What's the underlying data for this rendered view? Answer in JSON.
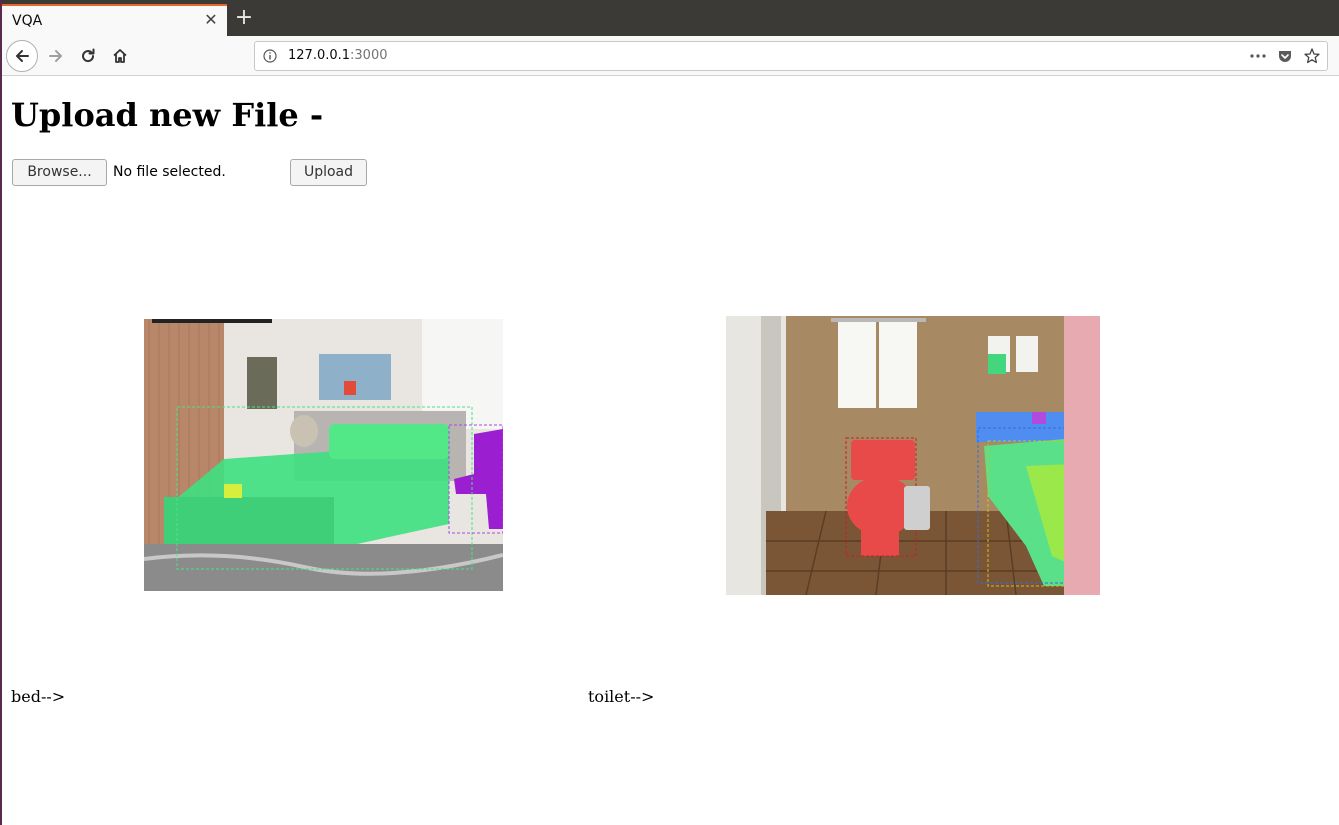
{
  "browser": {
    "tab_title": "VQA",
    "tab_close_glyph": "✕",
    "new_tab_glyph": "+",
    "url_host": "127.0.0.1",
    "url_port": ":3000",
    "icons": [
      "back-icon",
      "forward-icon",
      "reload-icon",
      "home-icon",
      "info-icon",
      "page-actions-icon",
      "pocket-icon",
      "bookmark-star-icon"
    ],
    "accent_color": "#e8672c"
  },
  "page": {
    "title": "Upload new File -",
    "browse_label": "Browse...",
    "file_status": "No file selected.",
    "upload_label": "Upload",
    "results": [
      {
        "answer": "bed-->"
      },
      {
        "answer": "toilet-->"
      }
    ]
  }
}
